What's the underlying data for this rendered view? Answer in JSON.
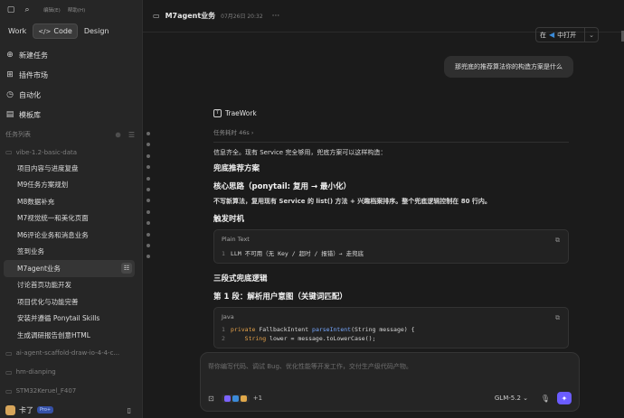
{
  "sidebar": {
    "menu": [
      "编辑(E)",
      "帮助(H)"
    ],
    "modes": [
      "Work",
      "Code",
      "Design"
    ],
    "nav": [
      {
        "label": "新建任务",
        "icon": "plus-icon"
      },
      {
        "label": "插件市场",
        "icon": "grid-icon"
      },
      {
        "label": "自动化",
        "icon": "clock-icon"
      },
      {
        "label": "模板库",
        "icon": "template-icon"
      }
    ],
    "tasks_header": "任务列表",
    "folders": [
      {
        "name": "vibe-1.2-basic-data",
        "tasks": [
          "项目内容与进度复盘",
          "M9任务方案规划",
          "M8数据补充",
          "M7视觉统一和美化页面",
          "M6评论业务和消息业务",
          "签到业务",
          "M7agent业务",
          "讨论首页功能开发",
          "项目优化与功能完善",
          "安装并遵循 Ponytail Skills",
          "生成调研报告创意HTML"
        ]
      }
    ],
    "other_folders": [
      "ai-agent-scaffold-draw-io-4-4-c...",
      "hm-dianping",
      "STM32Keruel_F407"
    ],
    "user": {
      "name": "卡了",
      "badge": "Pro+"
    }
  },
  "main": {
    "title": "M7agent业务",
    "date": "07月26日 20:32",
    "open_prefix": "在",
    "open_label": "中打开",
    "user_message": "那兜底的推荐算法你的构造方案是什么",
    "brand": "TraeWork",
    "elapsed": "任务耗时 46s",
    "intro": "信息齐全。现有 Service 完全够用，兜底方案可以这样构造：",
    "heading1": "兜底推荐方案",
    "heading2": "核心思路（ponytail: 复用 → 最小化）",
    "summary": "不写新算法，复用现有 Service 的 list() 方法 + 兴趣档案排序。整个兜底逻辑控制在 80 行内。",
    "heading3": "触发时机",
    "code1": {
      "lang": "Plain Text",
      "line_no": "1",
      "line": "LLM 不可用（无 Key / 超时 / 报错）→ 走兜底"
    },
    "heading4": "三段式兜底逻辑",
    "heading5": "第 1 段：解析用户意图（关键词匹配）",
    "code2": {
      "lang": "Java",
      "line1_no": "1",
      "kw1": "private",
      "type1": " FallbackIntent ",
      "fn1": "parseIntent",
      "rest1": "(String message) {",
      "line2_no": "2",
      "kw2": "String",
      "rest2": " lower = message.toLowerCase();"
    },
    "composer_placeholder": "帮你编写代码、调试 Bug、优化性能等开发工作，交付生产级代码产物。",
    "attach_extra": "+1",
    "model": "GLM-5.2"
  },
  "colors": {
    "accent": "#6b5cff",
    "vscode": "#3b8bd9"
  }
}
